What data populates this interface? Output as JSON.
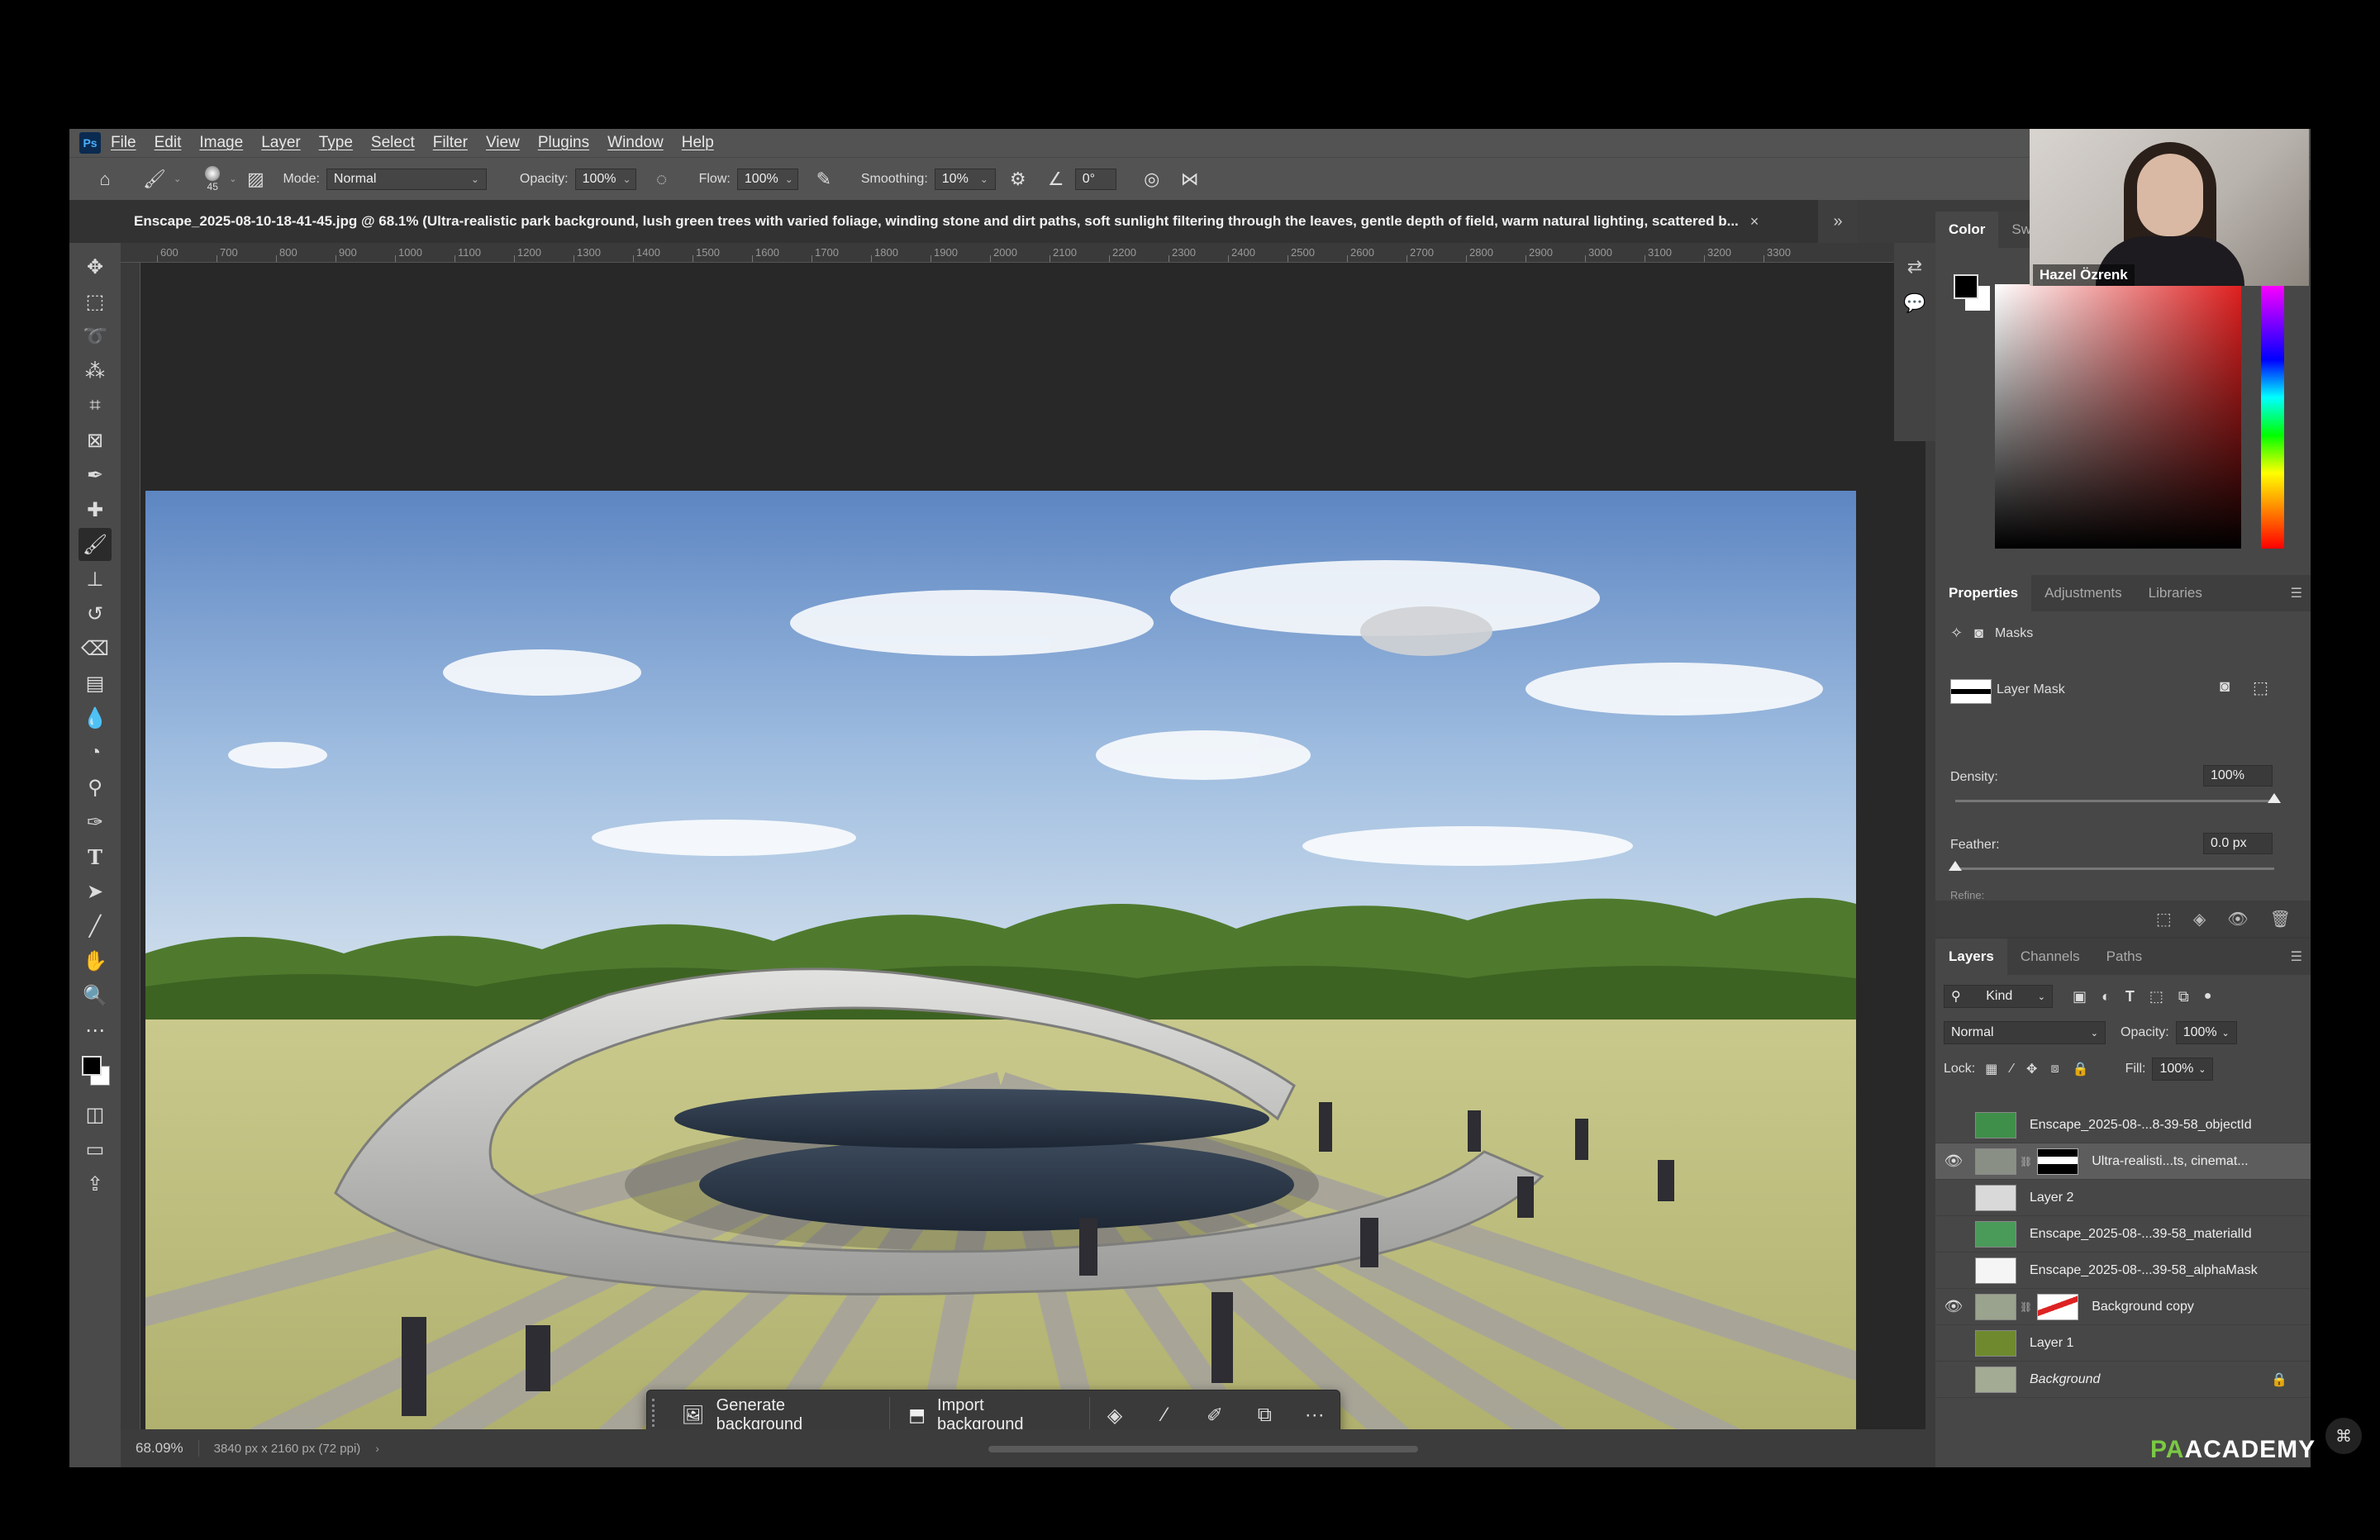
{
  "app": {
    "logo": "Ps"
  },
  "menu": [
    "File",
    "Edit",
    "Image",
    "Layer",
    "Type",
    "Select",
    "Filter",
    "View",
    "Plugins",
    "Window",
    "Help"
  ],
  "options": {
    "brush_size": "45",
    "mode_label": "Mode:",
    "mode_value": "Normal",
    "opacity_label": "Opacity:",
    "opacity_value": "100%",
    "flow_label": "Flow:",
    "flow_value": "100%",
    "smoothing_label": "Smoothing:",
    "smoothing_value": "10%",
    "angle_value": "0°"
  },
  "document": {
    "tab_title": "Enscape_2025-08-10-18-41-45.jpg @ 68.1% (Ultra-realistic park background, lush green trees with varied foliage, winding stone and dirt paths, soft sunlight filtering through the leaves, gentle depth of field, warm natural lighting, scattered b...",
    "close_glyph": "×"
  },
  "ruler_labels": [
    "600",
    "700",
    "800",
    "900",
    "1000",
    "1100",
    "1200",
    "1300",
    "1400",
    "1500",
    "1600",
    "1700",
    "1800",
    "1900",
    "2000",
    "2100",
    "2200",
    "2300",
    "2400",
    "2500",
    "2600",
    "2700",
    "2800",
    "2900",
    "3000",
    "3100",
    "3200",
    "3300"
  ],
  "taskbar": {
    "generate_label": "Generate background",
    "import_label": "Import background",
    "more_glyph": "···"
  },
  "status": {
    "zoom": "68.09%",
    "dimensions": "3840 px x 2160 px (72 ppi)"
  },
  "color_panel": {
    "tabs": [
      "Color",
      "Swa"
    ]
  },
  "properties_panel": {
    "tabs": [
      "Properties",
      "Adjustments",
      "Libraries"
    ],
    "section_label": "Masks",
    "mask_label": "Layer Mask",
    "density_label": "Density:",
    "density_value": "100%",
    "density_level": 1.0,
    "feather_label": "Feather:",
    "feather_value": "0.0 px",
    "feather_level": 0.0,
    "refine_label": "Refine:"
  },
  "layers_panel": {
    "tabs": [
      "Layers",
      "Channels",
      "Paths"
    ],
    "filter_value": "Kind",
    "blend_value": "Normal",
    "opacity_label": "Opacity:",
    "opacity_value": "100%",
    "lock_label": "Lock:",
    "fill_label": "Fill:",
    "fill_value": "100%",
    "layers": [
      {
        "name": "Enscape_2025-08-...8-39-58_objectId",
        "visible": false,
        "thumb_color": "#3f8f4a",
        "has_mask": false
      },
      {
        "name": "Ultra-realisti...ts, cinemat...",
        "visible": true,
        "thumb_color": "#8a8f86",
        "has_mask": true,
        "selected": true
      },
      {
        "name": "Layer 2",
        "visible": false,
        "thumb_color": "#d9d9d9",
        "has_mask": false
      },
      {
        "name": "Enscape_2025-08-...39-58_materialId",
        "visible": false,
        "thumb_color": "#4a9a5a",
        "has_mask": false
      },
      {
        "name": "Enscape_2025-08-...39-58_alphaMask",
        "visible": false,
        "thumb_color": "#f5f5f5",
        "has_mask": false
      },
      {
        "name": "Background copy",
        "visible": true,
        "thumb_color": "#9aa38d",
        "has_mask": true
      },
      {
        "name": "Layer 1",
        "visible": false,
        "thumb_color": "#6f8a2e",
        "has_mask": false
      },
      {
        "name": "Background",
        "visible": false,
        "thumb_color": "#a3ab94",
        "has_mask": false,
        "italic": true,
        "locked": true
      }
    ]
  },
  "webcam": {
    "name": "Hazel Özrenk"
  },
  "watermark": {
    "prefix": "PA",
    "rest": "ACADEMY"
  }
}
